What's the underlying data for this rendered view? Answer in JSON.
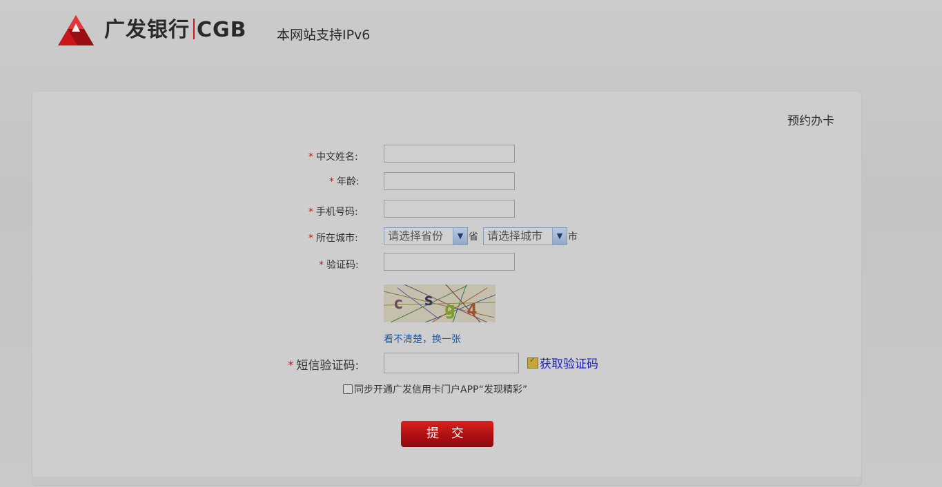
{
  "header": {
    "brand_cn": "广发银行",
    "brand_en": "CGB",
    "ipv6_note": "本网站支持IPv6"
  },
  "panel": {
    "title": "预约办卡"
  },
  "form": {
    "required_mark": "*",
    "name_label": "中文姓名:",
    "age_label": "年龄:",
    "phone_label": "手机号码:",
    "city_label": "所在城市:",
    "province_select": "请选择省份",
    "province_unit": "省",
    "city_select": "请选择城市",
    "city_unit": "市",
    "captcha_label": "验证码:",
    "captcha_refresh": "看不清楚，换一张",
    "sms_label": "短信验证码:",
    "get_sms": "获取验证码",
    "sync_app": "同步开通广发信用卡门户APP“发现精彩”",
    "submit": "提 交"
  },
  "colors": {
    "brand_red": "#c8161d",
    "link_blue": "#1f5aa6"
  }
}
